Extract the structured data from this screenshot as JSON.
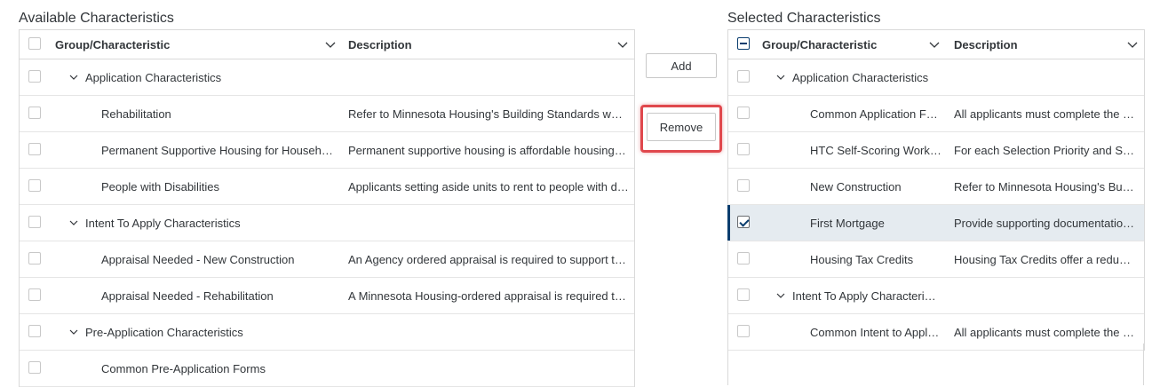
{
  "available": {
    "title": "Available Characteristics",
    "col_group": "Group/Characteristic",
    "col_desc": "Description",
    "rows": [
      {
        "name": "Application Characteristics",
        "desc": ""
      },
      {
        "name": "Rehabilitation",
        "desc": "Refer to Minnesota Housing's Building Standards we…"
      },
      {
        "name": "Permanent Supportive Housing for Househ…",
        "desc": "Permanent supportive housing is affordable housing …"
      },
      {
        "name": "People with Disabilities",
        "desc": "Applicants setting aside units to rent to people with di…"
      },
      {
        "name": "Intent To Apply Characteristics",
        "desc": ""
      },
      {
        "name": "Appraisal Needed - New Construction",
        "desc": "An Agency ordered appraisal is required to support t…"
      },
      {
        "name": "Appraisal Needed - Rehabilitation",
        "desc": "A Minnesota Housing-ordered appraisal is required t…"
      },
      {
        "name": "Pre-Application Characteristics",
        "desc": ""
      },
      {
        "name": "Common Pre-Application Forms",
        "desc": ""
      }
    ]
  },
  "actions": {
    "add_label": "Add",
    "remove_label": "Remove"
  },
  "selected": {
    "title": "Selected Characteristics",
    "col_group": "Group/Characteristic",
    "col_desc": "Description",
    "rows": [
      {
        "name": "Application Characteristics",
        "desc": ""
      },
      {
        "name": "Common Application F…",
        "desc": "All applicants must complete the …"
      },
      {
        "name": "HTC Self-Scoring Work…",
        "desc": "For each Selection Priority and S…"
      },
      {
        "name": "New Construction",
        "desc": "Refer to Minnesota Housing's Bu…"
      },
      {
        "name": "First Mortgage",
        "desc": "Provide supporting documentatio…"
      },
      {
        "name": "Housing Tax Credits",
        "desc": "Housing Tax Credits offer a redu…"
      },
      {
        "name": "Intent To Apply Characteri…",
        "desc": ""
      },
      {
        "name": "Common Intent to Appl…",
        "desc": "All applicants must complete the …"
      }
    ]
  },
  "colors": {
    "highlight": "#e0484d",
    "selected_row": "#e5ebf0",
    "accent": "#0a3d6e"
  }
}
